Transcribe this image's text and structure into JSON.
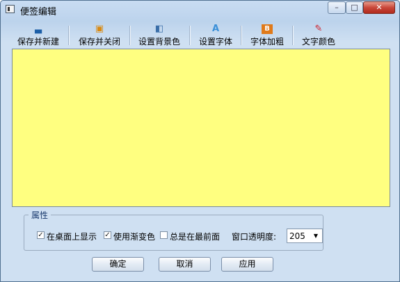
{
  "window": {
    "title": "便签编辑"
  },
  "titlebar": {
    "min_glyph": "–",
    "max_glyph": "□",
    "close_glyph": "✕"
  },
  "toolbar": {
    "items": [
      {
        "label": "保存并新建",
        "icon": "save-new-icon",
        "glyph": "▃"
      },
      {
        "label": "保存并关闭",
        "icon": "save-close-icon",
        "glyph": "▣"
      },
      {
        "label": "设置背景色",
        "icon": "background-color-icon",
        "glyph": "◧"
      },
      {
        "label": "设置字体",
        "icon": "font-icon",
        "glyph": "A"
      },
      {
        "label": "字体加粗",
        "icon": "bold-icon",
        "glyph": "B"
      },
      {
        "label": "文字颜色",
        "icon": "text-color-icon",
        "glyph": "✎"
      }
    ]
  },
  "editor": {
    "value": "",
    "background": "#ffff80"
  },
  "properties": {
    "title": "属性",
    "show_on_desktop": {
      "label": "在桌面上显示",
      "checked": true
    },
    "use_gradient": {
      "label": "使用渐变色",
      "checked": true
    },
    "always_on_top": {
      "label": "总是在最前面",
      "checked": false
    },
    "opacity_label": "窗口透明度:",
    "opacity_value": "205"
  },
  "buttons": {
    "ok": "确定",
    "cancel": "取消",
    "apply": "应用"
  },
  "colors": {
    "accent": "#1a3a6e",
    "close": "#c9473a"
  }
}
